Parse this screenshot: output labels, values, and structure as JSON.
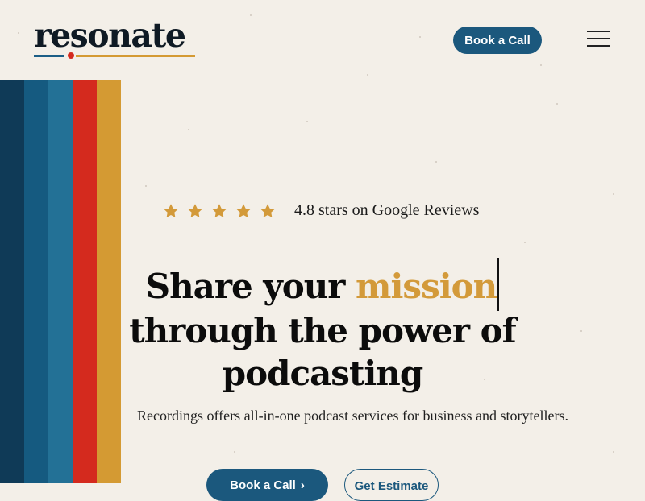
{
  "brand": {
    "name": "resonate"
  },
  "header": {
    "cta_label": "Book a Call",
    "menu_icon": "hamburger-menu-icon"
  },
  "colors": {
    "primary": "#1b587d",
    "accent": "#d39a3a",
    "background": "#f3efe8",
    "stripes": [
      "#0f3a57",
      "#155a80",
      "#237196",
      "#d42a1e",
      "#d49a33"
    ]
  },
  "rating": {
    "stars": 5,
    "text": "4.8 stars on Google Reviews",
    "icon": "star-icon"
  },
  "hero": {
    "headline_prefix": "Share your ",
    "headline_accent": "mission",
    "headline_line2": "through the power of",
    "headline_line3": "podcasting",
    "subtext": "Recordings offers all-in-one podcast services for business and storytellers."
  },
  "cta": {
    "primary_label": "Book a Call",
    "primary_icon": "chevron-right-icon",
    "secondary_label": "Get Estimate"
  }
}
